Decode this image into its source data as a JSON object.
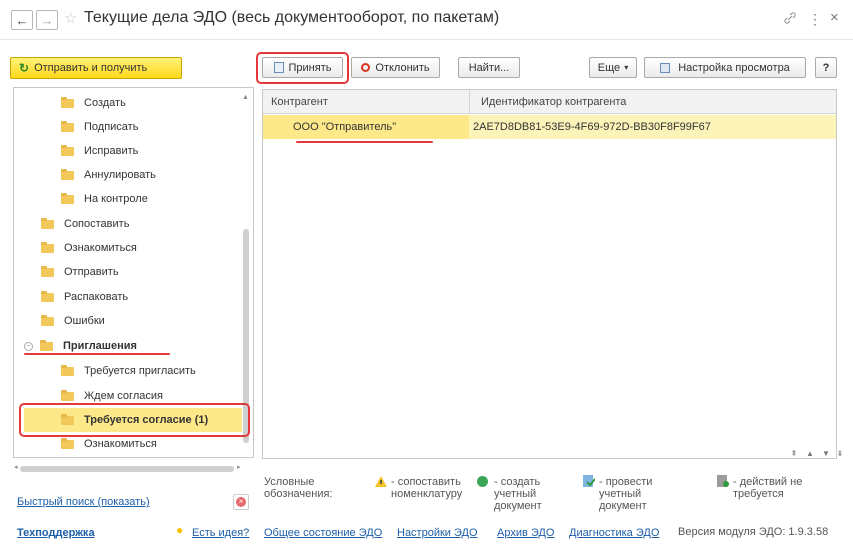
{
  "window": {
    "title": "Текущие дела ЭДО (весь документооборот, по пакетам)",
    "nav_back": "←",
    "nav_forward": "→",
    "star": "☆",
    "link_icon": "🔗",
    "more_icon": "⋮",
    "close_icon": "×"
  },
  "toolbar": {
    "send_label": "Отправить и получить",
    "accept_label": "Принять",
    "reject_label": "Отклонить",
    "find_label": "Найти...",
    "more_label": "Еще",
    "view_settings_label": "Настройка просмотра",
    "help_label": "?"
  },
  "tree": {
    "items": [
      {
        "label": "Создать"
      },
      {
        "label": "Подписать"
      },
      {
        "label": "Исправить"
      },
      {
        "label": "Аннулировать"
      },
      {
        "label": "На контроле"
      },
      {
        "label": "Сопоставить"
      },
      {
        "label": "Ознакомиться"
      },
      {
        "label": "Отправить"
      },
      {
        "label": "Распаковать"
      },
      {
        "label": "Ошибки"
      },
      {
        "label": "Приглашения"
      },
      {
        "label": "Требуется пригласить"
      },
      {
        "label": "Ждем согласия"
      },
      {
        "label": "Требуется согласие (1)"
      },
      {
        "label": "Ознакомиться"
      }
    ]
  },
  "grid": {
    "columns": [
      "Контрагент",
      "Идентификатор контрагента"
    ],
    "rows": [
      {
        "counterparty": "ООО \"Отправитель\"",
        "id": "2AE7D8DB81-53E9-4F69-972D-BB30F8F99F67"
      }
    ]
  },
  "legend": {
    "title": "Условные обозначения:",
    "items": [
      "- сопоставить номенклатуру",
      "- создать учетный документ",
      "- провести учетный документ",
      "- действий не требуется"
    ]
  },
  "quick_search": "Быстрый поиск (показать)",
  "footer": {
    "support": "Техподдержка",
    "idea": "Есть идея?",
    "status": "Общее состояние ЭДО",
    "settings": "Настройки ЭДО",
    "archive": "Архив ЭДО",
    "diagnostics": "Диагностика ЭДО",
    "version": "Версия модуля ЭДО: 1.9.3.58"
  },
  "colors": {
    "accent_yellow": "#ffd91a",
    "selection": "#fde98a",
    "highlight_red": "#e23a3a",
    "link_blue": "#1d5fa8"
  }
}
